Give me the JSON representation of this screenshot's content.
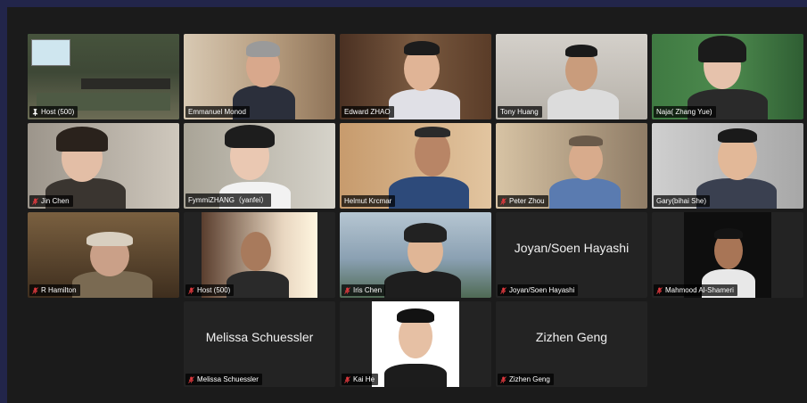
{
  "participants": [
    {
      "name": "Host (500)",
      "icon": "pin-icon",
      "bg": "#5b6a4f",
      "show_video": true
    },
    {
      "name": "Emmanuel Monod",
      "icon": "none",
      "bg": "#c9b79e",
      "show_video": true
    },
    {
      "name": "Edward ZHAO",
      "icon": "none",
      "bg": "#6a4a34",
      "show_video": true
    },
    {
      "name": "Tony Huang",
      "icon": "none",
      "bg": "#c7c3bc",
      "show_video": true
    },
    {
      "name": "Naja( Zhang Yue)",
      "icon": "none",
      "bg": "#4d8a4e",
      "show_video": true
    },
    {
      "name": "Jin Chen",
      "icon": "microphone-muted-icon",
      "bg": "#b8b0a6",
      "show_video": true
    },
    {
      "name": "FymmiZHANG（yanfei）",
      "icon": "none",
      "bg": "#c9c6bd",
      "show_video": true
    },
    {
      "name": "Helmut Krcmar",
      "icon": "none",
      "bg": "#c6a078",
      "show_video": true
    },
    {
      "name": "Peter Zhou",
      "icon": "microphone-muted-icon",
      "bg": "#b7a58c",
      "show_video": true
    },
    {
      "name": "Gary(bihai She)",
      "icon": "none",
      "bg": "#bcbcbc",
      "show_video": true
    },
    {
      "name": "R Hamilton",
      "icon": "microphone-muted-icon",
      "bg": "#6d5334",
      "show_video": true
    },
    {
      "name": "Host (500)",
      "icon": "microphone-muted-icon",
      "bg": "#3a2a20",
      "show_video": true
    },
    {
      "name": "Iris Chen",
      "icon": "microphone-muted-icon",
      "bg": "#8aa0b2",
      "show_video": true
    },
    {
      "name": "Joyan/Soen Hayashi",
      "icon": "microphone-muted-icon",
      "bg": "#232323",
      "show_video": false
    },
    {
      "name": "Mahmood Al-Shameri",
      "icon": "microphone-muted-icon",
      "bg": "#232323",
      "show_video": true
    },
    {
      "name": "Melissa Schuessler",
      "icon": "microphone-muted-icon",
      "bg": "#232323",
      "show_video": false
    },
    {
      "name": "Kai He",
      "icon": "microphone-muted-icon",
      "bg": "#232323",
      "show_video": true
    },
    {
      "name": "Zizhen Geng",
      "icon": "microphone-muted-icon",
      "bg": "#232323",
      "show_video": false
    }
  ],
  "colors": {
    "active_speaker_border": "#3ec35c",
    "muted_icon": "#e0393e",
    "window_bg": "#1b1b1b",
    "frame_bg": "#22254a"
  }
}
